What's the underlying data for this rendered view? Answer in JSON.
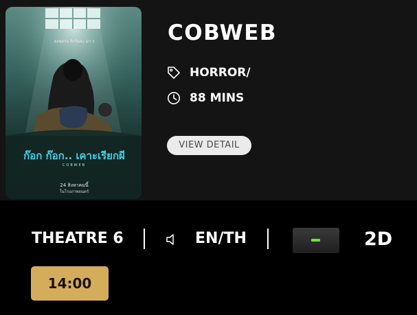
{
  "movie": {
    "title": "COBWEB",
    "genre": "HORROR/",
    "duration": "88 MINS",
    "view_detail_label": "VIEW DETAIL",
    "poster": {
      "tagline": "ลงชุดรอ รักวันจะ มา ว",
      "thai_title": "ก๊อก ก๊อก.. เคาะเรียกผี",
      "english_small": "COBWEB",
      "release_line_1": "24 สิงหาคมนี้",
      "release_line_2": "ในโรงภาพยนตร์"
    }
  },
  "session": {
    "theatre": "THEATRE 6",
    "language": "EN/TH",
    "format_symbol": "minus",
    "dimension": "2D",
    "showtime": "14:00"
  },
  "colors": {
    "background": "#000000",
    "card": "#141414",
    "showtime_button": "#d3ad5c",
    "format_indicator": "#6fe03a"
  }
}
